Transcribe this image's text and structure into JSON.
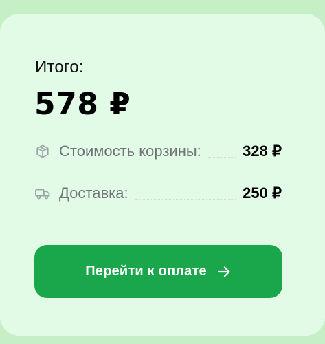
{
  "summary": {
    "total_label": "Итого:",
    "total_value": "578 ₽",
    "rows": [
      {
        "label": "Стоимость корзины:",
        "value": "328 ₽",
        "icon": "box-icon"
      },
      {
        "label": "Доставка:",
        "value": "250 ₽",
        "icon": "truck-icon"
      }
    ]
  },
  "actions": {
    "checkout_label": "Перейти к оплате",
    "checkout_icon": "arrow-right-icon"
  },
  "colors": {
    "page_background": "#c6efc6",
    "card_background": "#e2fbe7",
    "primary_button": "#1aa74b",
    "muted_text": "#6f7478"
  }
}
